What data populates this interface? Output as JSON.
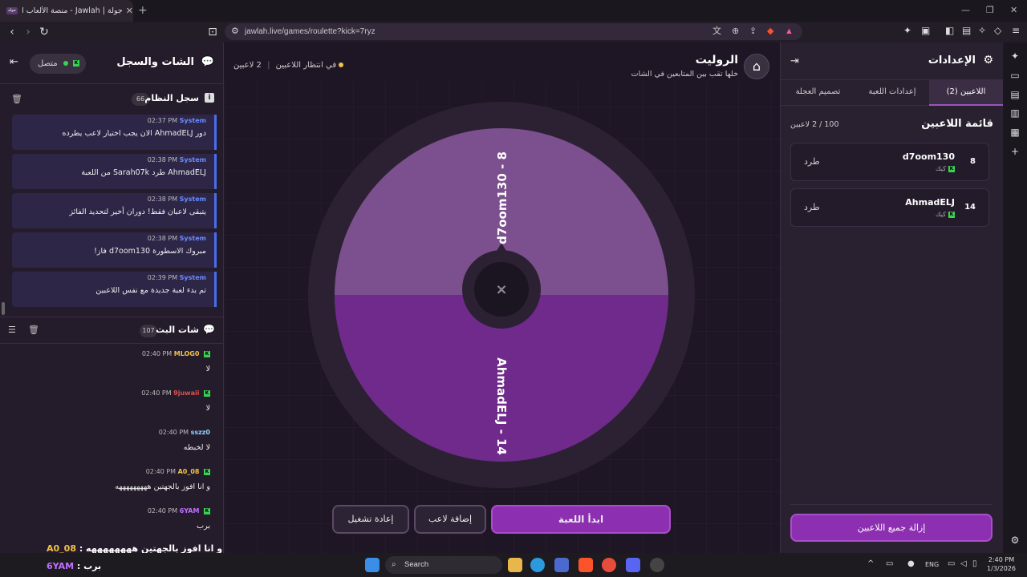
{
  "browser": {
    "tab_title": "جولة | Jawlah - منصة الألعاب التفا",
    "tab_badge": "جوله",
    "url": "jawlah.live/games/roulette?kick=7ryz"
  },
  "left_panel": {
    "title": "الشات والسجل",
    "status": "متصل",
    "system_log": {
      "title": "سجل النظام",
      "count": "66",
      "messages": [
        {
          "user": "System",
          "time": "02:37 PM",
          "text": "دور AhmadELJ الان يجب اختيار لاعب يطرده"
        },
        {
          "user": "System",
          "time": "02:38 PM",
          "text": "AhmadELJ طرد Sarah07k من اللعبة"
        },
        {
          "user": "System",
          "time": "02:38 PM",
          "text": "يتبقى لاعبان فقط! دوران أخير لتحديد الفائز"
        },
        {
          "user": "System",
          "time": "02:38 PM",
          "text": "مبروك الاسطورة d7oom130 فاز!"
        },
        {
          "user": "System",
          "time": "02:39 PM",
          "text": "تم بدء لعبة جديدة مع نفس اللاعبين"
        }
      ]
    },
    "live_chat": {
      "title": "شات البث",
      "count": "107",
      "messages": [
        {
          "user": "MLOG0",
          "time": "02:40 PM",
          "text": "لا",
          "color": "#f0c24a"
        },
        {
          "user": "9juwaii",
          "time": "02:40 PM",
          "text": "لا",
          "color": "#d9534f"
        },
        {
          "user": "sszz0",
          "time": "02:40 PM",
          "text": "لا لخبطه",
          "color": "#8fd3ff"
        },
        {
          "user": "A0_08",
          "time": "02:40 PM",
          "text": "و انا افوز بالجهتين هههههههههه",
          "color": "#f0c24a"
        },
        {
          "user": "6YAM",
          "time": "02:40 PM",
          "text": "برب",
          "color": "#c070ff"
        }
      ]
    },
    "overlay": [
      {
        "user": "A0_08",
        "text": "و انا افوز بالجهتين ههههههههه :"
      },
      {
        "user": "6YAM",
        "text": "برب :"
      }
    ]
  },
  "center": {
    "title": "الروليت",
    "subtitle": "خلها تقب بين المتابعين في الشات",
    "players_count": "2 لاعبين",
    "waiting": "في انتظار اللاعبين",
    "wheel": {
      "segments": [
        {
          "label": "d7oom130 - 8",
          "color": "#7c4f8e"
        },
        {
          "label": "AhmadELJ - 14",
          "color": "#6f2a8c"
        }
      ]
    },
    "buttons": {
      "start": "ابدأ اللعبة",
      "add": "إضافة لاعب",
      "restart": "إعادة تشغيل"
    }
  },
  "right_panel": {
    "title": "الإعدادات",
    "tabs": [
      "اللاعبين (2)",
      "إعدادات اللعبة",
      "تصميم العجلة"
    ],
    "list_title": "قائمة اللاعبين",
    "list_count": "100 / 2 لاعبين",
    "players": [
      {
        "name": "d7oom130",
        "source": "كيك",
        "number": "8",
        "kick_label": "طرد"
      },
      {
        "name": "AhmadELJ",
        "source": "كيك",
        "number": "14",
        "kick_label": "طرد"
      }
    ],
    "remove_all": "إزالة جميع اللاعبين"
  },
  "taskbar": {
    "search": "Search",
    "lang": "ENG",
    "time": "2:40 PM",
    "date": "1/3/2026"
  }
}
